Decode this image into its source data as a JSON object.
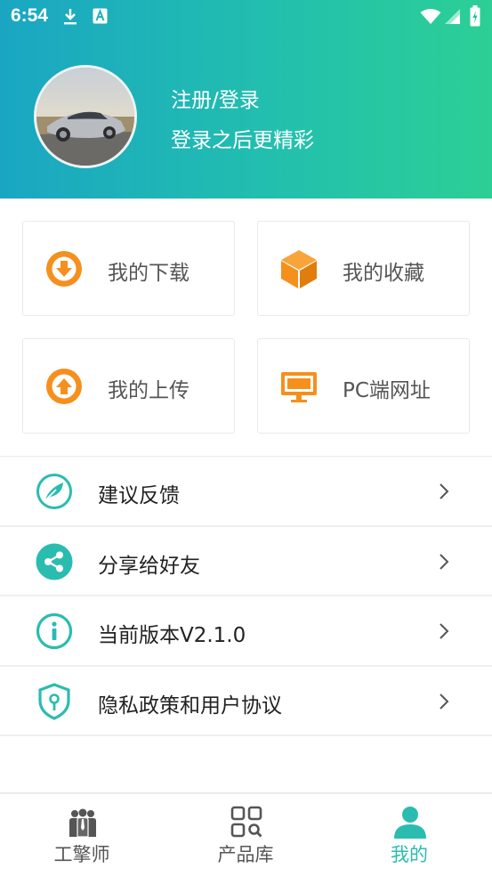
{
  "status_bar": {
    "time": "6:54",
    "left_icons": [
      "download-icon",
      "font-a-icon"
    ],
    "right_icons": [
      "wifi-icon",
      "signal-icon",
      "battery-icon"
    ]
  },
  "profile": {
    "title": "注册/登录",
    "subtitle": "登录之后更精彩",
    "avatar": "car-avatar"
  },
  "grid": [
    {
      "label": "我的下载",
      "icon": "download-circle-icon",
      "color": "#f5901d"
    },
    {
      "label": "我的收藏",
      "icon": "box-icon",
      "color": "#f5901d"
    },
    {
      "label": "我的上传",
      "icon": "upload-circle-icon",
      "color": "#f5901d"
    },
    {
      "label": "PC端网址",
      "icon": "monitor-icon",
      "color": "#f5901d"
    }
  ],
  "list": [
    {
      "label": "建议反馈",
      "icon": "feather-icon"
    },
    {
      "label": "分享给好友",
      "icon": "share-icon"
    },
    {
      "label": "当前版本V2.1.0",
      "icon": "info-icon"
    },
    {
      "label": "隐私政策和用户协议",
      "icon": "shield-lock-icon"
    }
  ],
  "bottom_nav": [
    {
      "label": "工擎师",
      "icon": "people-icon",
      "active": false
    },
    {
      "label": "产品库",
      "icon": "grid-search-icon",
      "active": false
    },
    {
      "label": "我的",
      "icon": "person-icon",
      "active": true
    }
  ],
  "colors": {
    "header_start": "#1aa6c3",
    "header_end": "#2ccf95",
    "accent": "#2bbcb0",
    "orange": "#f5901d"
  }
}
